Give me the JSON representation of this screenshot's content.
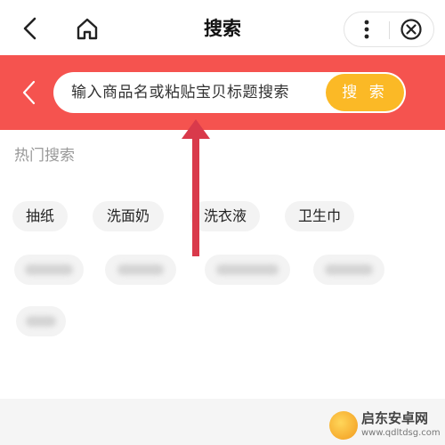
{
  "header": {
    "title": "搜索"
  },
  "search": {
    "placeholder": "输入商品名或粘贴宝贝标题搜索",
    "button_label": "搜 索"
  },
  "hot": {
    "title": "热门搜索",
    "chips": [
      "抽纸",
      "洗面奶",
      "洗衣液",
      "卫生巾"
    ]
  },
  "watermark": {
    "name": "启东安卓网",
    "url": "www.qdltdsg.com"
  },
  "colors": {
    "brand_red": "#f5534f",
    "search_button": "#fbb926",
    "arrow": "#d93a4b"
  }
}
